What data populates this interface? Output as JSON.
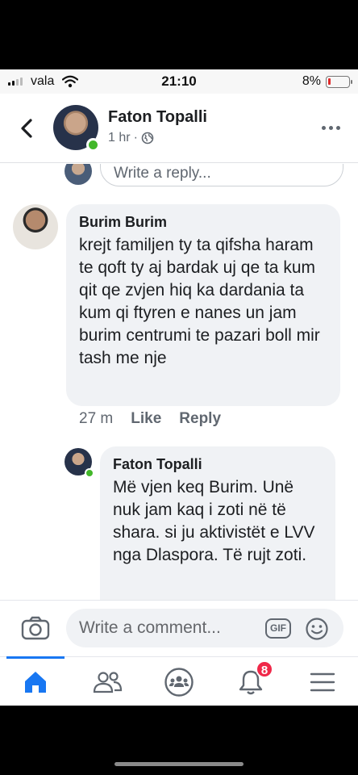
{
  "status": {
    "carrier": "vala",
    "time": "21:10",
    "battery": "8%",
    "battery_level": 0.08
  },
  "header": {
    "name": "Faton Topalli",
    "time": "1 hr",
    "separator": "·",
    "privacy_icon": "globe-icon",
    "more_icon": "more-horizontal-icon"
  },
  "feed": {
    "reply_placeholder": "Write a reply...",
    "comment1": {
      "author": "Burim Burim",
      "text": "krejt familjen ty ta qifsha haram te qoft ty aj bardak uj qe ta kum qit qe zvjen hiq ka dardania ta kum qi ftyren e nanes un jam burim centrumi te pazari boll mir tash me nje",
      "time": "27 m",
      "like": "Like",
      "reply": "Reply"
    },
    "comment2": {
      "author": "Faton Topalli",
      "text": "Më vjen keq Burim. Unë nuk jam kaq i zoti në të shara. si ju aktivistët e LVV nga Dlaspora. Të rujt zoti."
    }
  },
  "composer": {
    "placeholder": "Write a comment...",
    "gif_label": "GIF"
  },
  "tabbar": {
    "notifications_badge": "8",
    "active_tab": "home",
    "accent": "#1877f2"
  }
}
